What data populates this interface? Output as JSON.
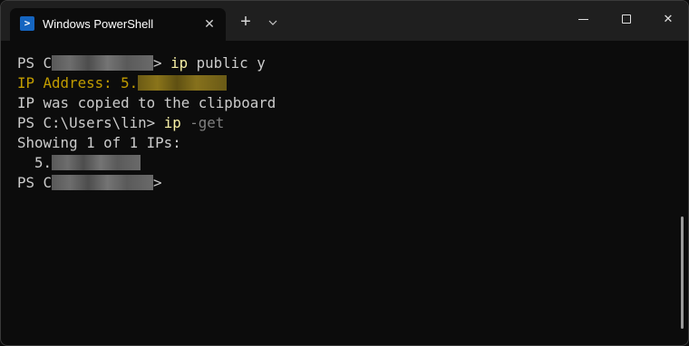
{
  "titlebar": {
    "tab_title": "Windows PowerShell",
    "tab_icon": "powershell-icon",
    "tab_close": "✕",
    "new_tab": "+",
    "dropdown": "⌄",
    "minimize": "minimize-icon",
    "maximize": "maximize-icon",
    "close": "✕"
  },
  "terminal": {
    "lines": [
      {
        "prompt_start": "PS C",
        "command": "ip",
        "args": " public y"
      },
      {
        "label": "IP Address: 5."
      },
      {
        "text": "IP was copied to the clipboard"
      },
      {
        "prompt": "PS C:\\Users\\lin> ",
        "command": "ip",
        "args": " -get"
      },
      {
        "text": "Showing 1 of 1 IPs:"
      },
      {
        "indent_text": "  5."
      },
      {
        "prompt_start": "PS C",
        "prompt_end": ">"
      }
    ],
    "redaction_color": "#666666"
  },
  "colors": {
    "background": "#0c0c0c",
    "titlebar": "#1f1f1f",
    "command": "#f9f1a5",
    "address": "#c19c00",
    "parameter": "#808080",
    "text": "#cccccc"
  }
}
